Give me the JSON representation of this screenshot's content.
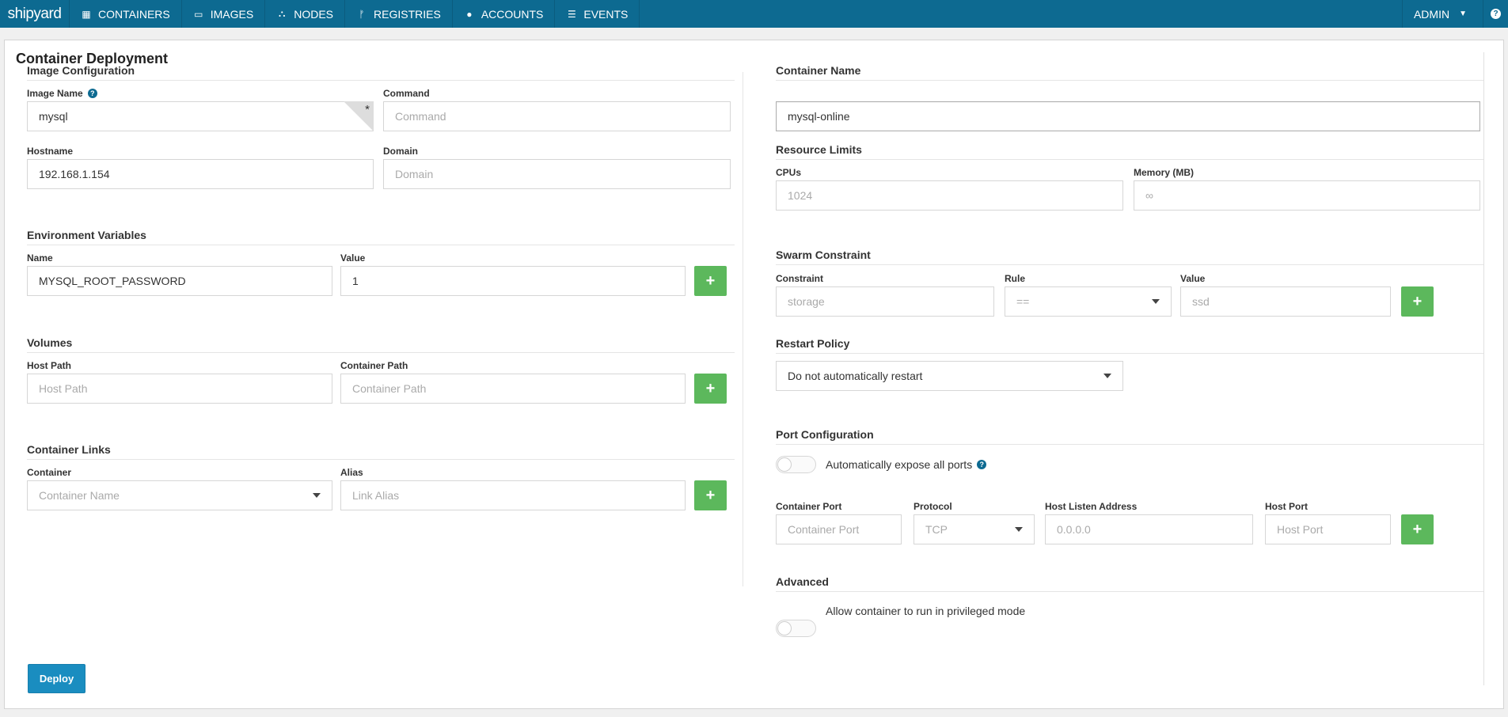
{
  "nav": {
    "logo": "shipyard",
    "items": [
      {
        "label": "CONTAINERS",
        "icon": "grid-icon"
      },
      {
        "label": "IMAGES",
        "icon": "drive-icon"
      },
      {
        "label": "NODES",
        "icon": "sitemap-icon"
      },
      {
        "label": "REGISTRIES",
        "icon": "fork-icon"
      },
      {
        "label": "ACCOUNTS",
        "icon": "user-icon"
      },
      {
        "label": "EVENTS",
        "icon": "list-icon"
      }
    ],
    "user": "ADMIN",
    "help_icon": "question-icon"
  },
  "page": {
    "title": "Container Deployment",
    "image_config": {
      "title": "Image Configuration",
      "image_name_label": "Image Name",
      "image_name_value": "mysql",
      "command_label": "Command",
      "command_placeholder": "Command",
      "hostname_label": "Hostname",
      "hostname_value": "192.168.1.154",
      "domain_label": "Domain",
      "domain_placeholder": "Domain"
    },
    "env": {
      "title": "Environment Variables",
      "name_label": "Name",
      "name_value": "MYSQL_ROOT_PASSWORD",
      "value_label": "Value",
      "value_value": "1"
    },
    "volumes": {
      "title": "Volumes",
      "host_path_label": "Host Path",
      "host_path_placeholder": "Host Path",
      "container_path_label": "Container Path",
      "container_path_placeholder": "Container Path"
    },
    "links": {
      "title": "Container Links",
      "container_label": "Container",
      "container_placeholder": "Container Name",
      "alias_label": "Alias",
      "alias_placeholder": "Link Alias"
    },
    "container_name": {
      "title": "Container Name",
      "value": "mysql-online"
    },
    "resources": {
      "title": "Resource Limits",
      "cpus_label": "CPUs",
      "cpus_placeholder": "1024",
      "memory_label": "Memory (MB)",
      "memory_placeholder": "∞"
    },
    "swarm": {
      "title": "Swarm Constraint",
      "constraint_label": "Constraint",
      "constraint_placeholder": "storage",
      "rule_label": "Rule",
      "rule_value": "==",
      "value_label": "Value",
      "value_placeholder": "ssd"
    },
    "restart": {
      "title": "Restart Policy",
      "value": "Do not automatically restart"
    },
    "ports": {
      "title": "Port Configuration",
      "expose_label": "Automatically expose all ports",
      "container_port_label": "Container Port",
      "container_port_placeholder": "Container Port",
      "protocol_label": "Protocol",
      "protocol_value": "TCP",
      "host_addr_label": "Host Listen Address",
      "host_addr_placeholder": "0.0.0.0",
      "host_port_label": "Host Port",
      "host_port_placeholder": "Host Port"
    },
    "advanced": {
      "title": "Advanced",
      "privileged_label": "Allow container to run in privileged mode"
    },
    "deploy_label": "Deploy",
    "add_symbol": "+"
  }
}
